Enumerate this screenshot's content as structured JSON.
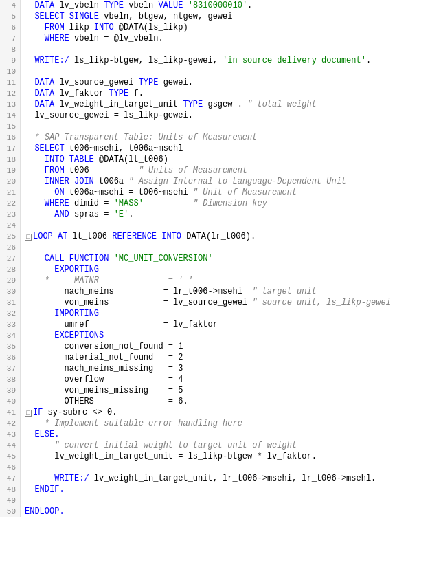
{
  "lines": [
    {
      "num": 4,
      "indent": 2,
      "tokens": [
        {
          "t": "kw",
          "v": "DATA"
        },
        {
          "t": "plain",
          "v": " lv_vbeln "
        },
        {
          "t": "kw",
          "v": "TYPE"
        },
        {
          "t": "plain",
          "v": " vbeln "
        },
        {
          "t": "kw",
          "v": "VALUE"
        },
        {
          "t": "plain",
          "v": " "
        },
        {
          "t": "str",
          "v": "'8310000010'"
        },
        {
          "t": "plain",
          "v": "."
        }
      ]
    },
    {
      "num": 5,
      "indent": 2,
      "tokens": [
        {
          "t": "kw",
          "v": "SELECT SINGLE"
        },
        {
          "t": "plain",
          "v": " vbeln, btgew, ntgew, gewei"
        }
      ]
    },
    {
      "num": 6,
      "indent": 4,
      "tokens": [
        {
          "t": "kw",
          "v": "FROM"
        },
        {
          "t": "plain",
          "v": " likp "
        },
        {
          "t": "kw",
          "v": "INTO"
        },
        {
          "t": "plain",
          "v": " @DATA(ls_likp)"
        }
      ]
    },
    {
      "num": 7,
      "indent": 4,
      "tokens": [
        {
          "t": "kw",
          "v": "WHERE"
        },
        {
          "t": "plain",
          "v": " vbeln = @lv_vbeln."
        }
      ]
    },
    {
      "num": 8,
      "indent": 0,
      "tokens": []
    },
    {
      "num": 9,
      "indent": 2,
      "tokens": [
        {
          "t": "kw",
          "v": "WRITE:/"
        },
        {
          "t": "plain",
          "v": " ls_likp-btgew, ls_likp-gewei, "
        },
        {
          "t": "str",
          "v": "'in source delivery document'"
        },
        {
          "t": "plain",
          "v": "."
        }
      ]
    },
    {
      "num": 10,
      "indent": 0,
      "tokens": []
    },
    {
      "num": 11,
      "indent": 2,
      "tokens": [
        {
          "t": "kw",
          "v": "DATA"
        },
        {
          "t": "plain",
          "v": " lv_source_gewei "
        },
        {
          "t": "kw",
          "v": "TYPE"
        },
        {
          "t": "plain",
          "v": " gewei."
        }
      ]
    },
    {
      "num": 12,
      "indent": 2,
      "tokens": [
        {
          "t": "kw",
          "v": "DATA"
        },
        {
          "t": "plain",
          "v": " lv_faktor "
        },
        {
          "t": "kw",
          "v": "TYPE"
        },
        {
          "t": "plain",
          "v": " f."
        }
      ]
    },
    {
      "num": 13,
      "indent": 2,
      "tokens": [
        {
          "t": "kw",
          "v": "DATA"
        },
        {
          "t": "plain",
          "v": " lv_weight_in_target_unit "
        },
        {
          "t": "kw",
          "v": "TYPE"
        },
        {
          "t": "plain",
          "v": " gsgew . "
        },
        {
          "t": "comment",
          "v": "\" total weight"
        }
      ]
    },
    {
      "num": 14,
      "indent": 2,
      "tokens": [
        {
          "t": "plain",
          "v": "lv_source_gewei = ls_likp-gewei."
        }
      ]
    },
    {
      "num": 15,
      "indent": 0,
      "tokens": []
    },
    {
      "num": 16,
      "indent": 2,
      "tokens": [
        {
          "t": "comment",
          "v": "* SAP Transparent Table: Units of Measurement"
        }
      ]
    },
    {
      "num": 17,
      "indent": 2,
      "tokens": [
        {
          "t": "kw",
          "v": "SELECT"
        },
        {
          "t": "plain",
          "v": " t006~msehi, t006a~msehl"
        }
      ]
    },
    {
      "num": 18,
      "indent": 4,
      "tokens": [
        {
          "t": "kw",
          "v": "INTO TABLE"
        },
        {
          "t": "plain",
          "v": " @DATA(lt_t006)"
        }
      ]
    },
    {
      "num": 19,
      "indent": 4,
      "tokens": [
        {
          "t": "kw",
          "v": "FROM"
        },
        {
          "t": "plain",
          "v": " t006          "
        },
        {
          "t": "comment",
          "v": "\" Units of Measurement"
        }
      ]
    },
    {
      "num": 20,
      "indent": 4,
      "tokens": [
        {
          "t": "kw",
          "v": "INNER JOIN"
        },
        {
          "t": "plain",
          "v": " t006a "
        },
        {
          "t": "comment",
          "v": "\" Assign Internal to Language-Dependent Unit"
        }
      ]
    },
    {
      "num": 21,
      "indent": 6,
      "tokens": [
        {
          "t": "kw",
          "v": "ON"
        },
        {
          "t": "plain",
          "v": " t006a~msehi = t006~msehi "
        },
        {
          "t": "comment",
          "v": "\" Unit of Measurement"
        }
      ]
    },
    {
      "num": 22,
      "indent": 4,
      "tokens": [
        {
          "t": "kw",
          "v": "WHERE"
        },
        {
          "t": "plain",
          "v": " dimid = "
        },
        {
          "t": "str",
          "v": "'MASS'"
        },
        {
          "t": "plain",
          "v": "          "
        },
        {
          "t": "comment",
          "v": "\" Dimension key"
        }
      ]
    },
    {
      "num": 23,
      "indent": 6,
      "tokens": [
        {
          "t": "kw",
          "v": "AND"
        },
        {
          "t": "plain",
          "v": " spras = "
        },
        {
          "t": "str",
          "v": "'E'"
        },
        {
          "t": "plain",
          "v": "."
        }
      ]
    },
    {
      "num": 24,
      "indent": 0,
      "tokens": []
    },
    {
      "num": 25,
      "indent": 0,
      "tokens": [
        {
          "t": "collapse",
          "v": "□"
        },
        {
          "t": "kw",
          "v": "LOOP AT"
        },
        {
          "t": "plain",
          "v": " lt_t006 "
        },
        {
          "t": "kw",
          "v": "REFERENCE INTO"
        },
        {
          "t": "plain",
          "v": " DATA(lr_t006)."
        }
      ]
    },
    {
      "num": 26,
      "indent": 0,
      "tokens": []
    },
    {
      "num": 27,
      "indent": 4,
      "tokens": [
        {
          "t": "kw",
          "v": "CALL FUNCTION"
        },
        {
          "t": "plain",
          "v": " "
        },
        {
          "t": "str",
          "v": "'MC_UNIT_CONVERSION'"
        }
      ]
    },
    {
      "num": 28,
      "indent": 6,
      "tokens": [
        {
          "t": "kw",
          "v": "EXPORTING"
        }
      ]
    },
    {
      "num": 29,
      "indent": 4,
      "tokens": [
        {
          "t": "comment",
          "v": "*     MATNR              = ' '"
        }
      ]
    },
    {
      "num": 30,
      "indent": 8,
      "tokens": [
        {
          "t": "plain",
          "v": "nach_meins          = lr_t006->msehi  "
        },
        {
          "t": "comment",
          "v": "\" target unit"
        }
      ]
    },
    {
      "num": 31,
      "indent": 8,
      "tokens": [
        {
          "t": "plain",
          "v": "von_meins           = lv_source_gewei "
        },
        {
          "t": "comment",
          "v": "\" source unit, ls_likp-gewei"
        }
      ]
    },
    {
      "num": 32,
      "indent": 6,
      "tokens": [
        {
          "t": "kw",
          "v": "IMPORTING"
        }
      ]
    },
    {
      "num": 33,
      "indent": 8,
      "tokens": [
        {
          "t": "plain",
          "v": "umref               = lv_faktor"
        }
      ]
    },
    {
      "num": 34,
      "indent": 6,
      "tokens": [
        {
          "t": "kw",
          "v": "EXCEPTIONS"
        }
      ]
    },
    {
      "num": 35,
      "indent": 8,
      "tokens": [
        {
          "t": "plain",
          "v": "conversion_not_found = 1"
        }
      ]
    },
    {
      "num": 36,
      "indent": 8,
      "tokens": [
        {
          "t": "plain",
          "v": "material_not_found   = 2"
        }
      ]
    },
    {
      "num": 37,
      "indent": 8,
      "tokens": [
        {
          "t": "plain",
          "v": "nach_meins_missing   = 3"
        }
      ]
    },
    {
      "num": 38,
      "indent": 8,
      "tokens": [
        {
          "t": "plain",
          "v": "overflow             = 4"
        }
      ]
    },
    {
      "num": 39,
      "indent": 8,
      "tokens": [
        {
          "t": "plain",
          "v": "von_meins_missing    = 5"
        }
      ]
    },
    {
      "num": 40,
      "indent": 8,
      "tokens": [
        {
          "t": "plain",
          "v": "OTHERS               = 6."
        }
      ]
    },
    {
      "num": 41,
      "indent": 0,
      "tokens": [
        {
          "t": "collapse",
          "v": "□"
        },
        {
          "t": "kw",
          "v": "IF"
        },
        {
          "t": "plain",
          "v": " sy-subrc <> 0."
        }
      ]
    },
    {
      "num": 42,
      "indent": 4,
      "tokens": [
        {
          "t": "comment",
          "v": "* Implement suitable error handling here"
        }
      ]
    },
    {
      "num": 43,
      "indent": 2,
      "tokens": [
        {
          "t": "kw",
          "v": "ELSE."
        }
      ]
    },
    {
      "num": 44,
      "indent": 6,
      "tokens": [
        {
          "t": "comment",
          "v": "\" convert initial weight to target unit of weight"
        }
      ]
    },
    {
      "num": 45,
      "indent": 6,
      "tokens": [
        {
          "t": "plain",
          "v": "lv_weight_in_target_unit = ls_likp-btgew * lv_faktor."
        }
      ]
    },
    {
      "num": 46,
      "indent": 0,
      "tokens": []
    },
    {
      "num": 47,
      "indent": 6,
      "tokens": [
        {
          "t": "kw",
          "v": "WRITE:/"
        },
        {
          "t": "plain",
          "v": " lv_weight_in_target_unit, lr_t006->msehi, lr_t006->msehl."
        }
      ]
    },
    {
      "num": 48,
      "indent": 2,
      "tokens": [
        {
          "t": "kw",
          "v": "ENDIF."
        }
      ]
    },
    {
      "num": 49,
      "indent": 0,
      "tokens": []
    },
    {
      "num": 50,
      "indent": 0,
      "tokens": [
        {
          "t": "kw",
          "v": "ENDLOOP."
        }
      ]
    }
  ]
}
